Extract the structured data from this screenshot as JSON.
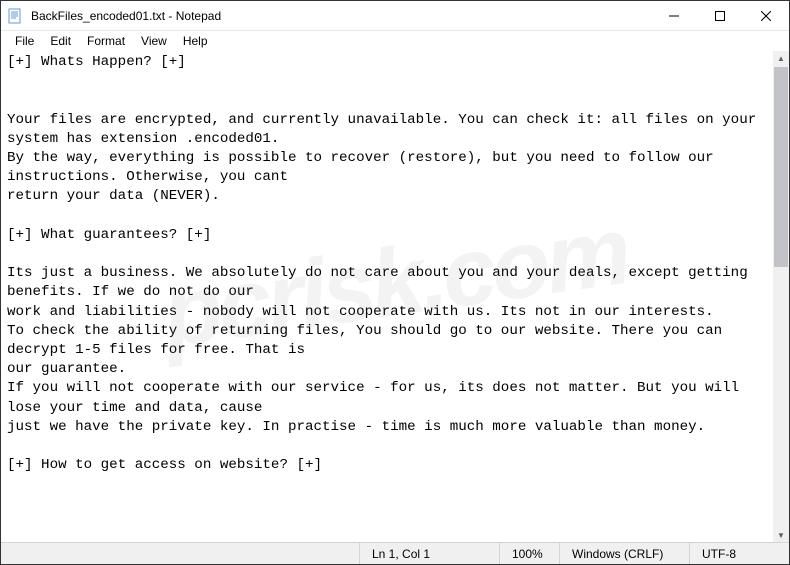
{
  "title": "BackFiles_encoded01.txt - Notepad",
  "menu": {
    "file": "File",
    "edit": "Edit",
    "format": "Format",
    "view": "View",
    "help": "Help"
  },
  "text": "[+] Whats Happen? [+]\n\n\nYour files are encrypted, and currently unavailable. You can check it: all files on your system has extension .encoded01.\nBy the way, everything is possible to recover (restore), but you need to follow our instructions. Otherwise, you cant\nreturn your data (NEVER).\n\n[+] What guarantees? [+]\n\nIts just a business. We absolutely do not care about you and your deals, except getting benefits. If we do not do our\nwork and liabilities - nobody will not cooperate with us. Its not in our interests.\nTo check the ability of returning files, You should go to our website. There you can decrypt 1-5 files for free. That is\nour guarantee.\nIf you will not cooperate with our service - for us, its does not matter. But you will lose your time and data, cause\njust we have the private key. In practise - time is much more valuable than money.\n\n[+] How to get access on website? [+]",
  "status": {
    "position": "Ln 1, Col 1",
    "zoom": "100%",
    "lineending": "Windows (CRLF)",
    "encoding": "UTF-8"
  },
  "watermark": "pcrisk.com"
}
